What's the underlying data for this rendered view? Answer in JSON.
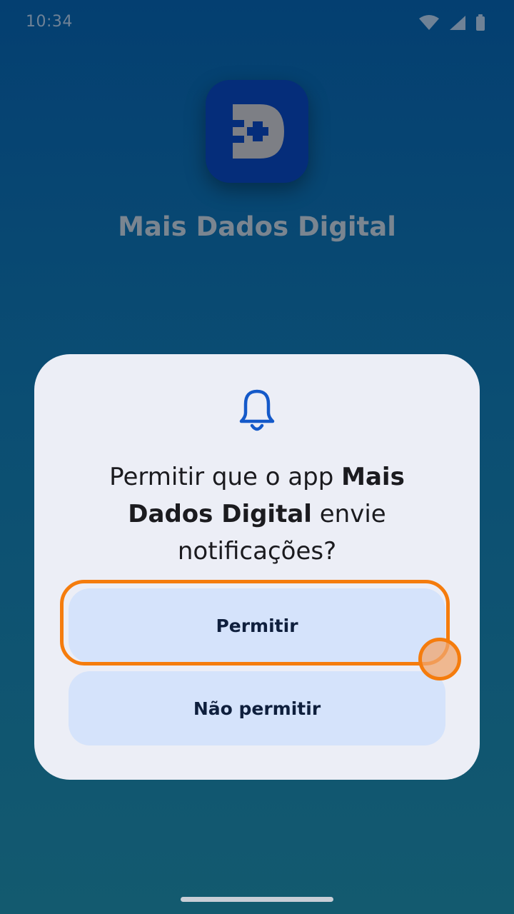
{
  "status_bar": {
    "time": "10:34",
    "icons": [
      "wifi-icon",
      "signal-icon",
      "battery-icon"
    ]
  },
  "app": {
    "name": "Mais Dados Digital",
    "icon": "app-logo-icon",
    "icon_color": "#052d7a"
  },
  "dialog": {
    "icon": "bell-icon",
    "title_prefix": "Permitir que o app ",
    "title_app_name": "Mais Dados Digital",
    "title_suffix": " envie notificações?",
    "allow_label": "Permitir",
    "deny_label": "Não permitir",
    "accent_color": "#1459c9",
    "button_color": "#d5e3fb"
  },
  "highlight_color": "#f57c0d"
}
